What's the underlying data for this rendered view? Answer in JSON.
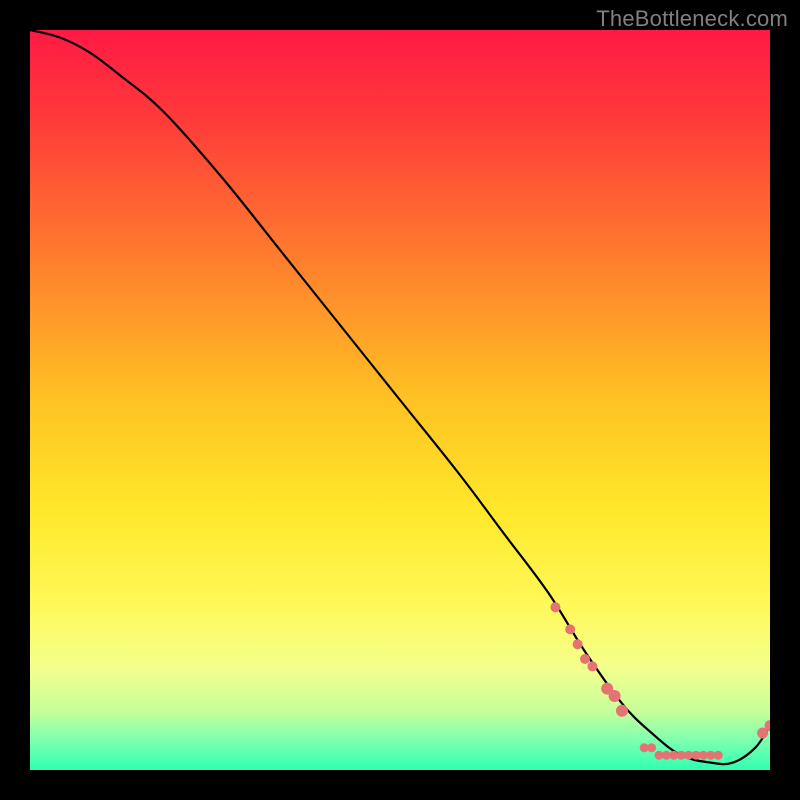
{
  "watermark": "TheBottleneck.com",
  "chart_data": {
    "type": "line",
    "title": "",
    "xlabel": "",
    "ylabel": "",
    "xlim": [
      0,
      100
    ],
    "ylim": [
      0,
      100
    ],
    "grid": false,
    "legend": false,
    "gradient_stops": [
      {
        "offset": 0,
        "color": "#ff1a44"
      },
      {
        "offset": 0.12,
        "color": "#ff3a3a"
      },
      {
        "offset": 0.3,
        "color": "#ff7a2e"
      },
      {
        "offset": 0.5,
        "color": "#ffc223"
      },
      {
        "offset": 0.65,
        "color": "#ffe82a"
      },
      {
        "offset": 0.78,
        "color": "#fff95a"
      },
      {
        "offset": 0.86,
        "color": "#f4ff8c"
      },
      {
        "offset": 0.92,
        "color": "#c7ff9a"
      },
      {
        "offset": 0.96,
        "color": "#7dffb0"
      },
      {
        "offset": 1.0,
        "color": "#2fffb0"
      }
    ],
    "series": [
      {
        "name": "bottleneck-curve",
        "x": [
          0,
          4,
          8,
          12,
          18,
          26,
          34,
          42,
          50,
          58,
          64,
          70,
          75,
          80,
          84,
          88,
          92,
          95,
          98,
          100
        ],
        "y": [
          100,
          99,
          97,
          94,
          89,
          80,
          70,
          60,
          50,
          40,
          32,
          24,
          16,
          9,
          5,
          2,
          1,
          1,
          3,
          6
        ]
      }
    ],
    "markers": [
      {
        "x": 71,
        "y": 22,
        "r": 5.0
      },
      {
        "x": 73,
        "y": 19,
        "r": 5.0
      },
      {
        "x": 74,
        "y": 17,
        "r": 5.0
      },
      {
        "x": 75,
        "y": 15,
        "r": 5.0
      },
      {
        "x": 76,
        "y": 14,
        "r": 5.0
      },
      {
        "x": 78,
        "y": 11,
        "r": 6.0
      },
      {
        "x": 79,
        "y": 10,
        "r": 6.0
      },
      {
        "x": 80,
        "y": 8,
        "r": 6.0
      },
      {
        "x": 83,
        "y": 3,
        "r": 4.5
      },
      {
        "x": 84,
        "y": 3,
        "r": 4.5
      },
      {
        "x": 85,
        "y": 2,
        "r": 4.5
      },
      {
        "x": 86,
        "y": 2,
        "r": 4.5
      },
      {
        "x": 87,
        "y": 2,
        "r": 4.5
      },
      {
        "x": 88,
        "y": 2,
        "r": 4.5
      },
      {
        "x": 89,
        "y": 2,
        "r": 4.5
      },
      {
        "x": 90,
        "y": 2,
        "r": 4.5
      },
      {
        "x": 91,
        "y": 2,
        "r": 4.5
      },
      {
        "x": 92,
        "y": 2,
        "r": 4.5
      },
      {
        "x": 93,
        "y": 2,
        "r": 4.5
      },
      {
        "x": 99,
        "y": 5,
        "r": 5.5
      },
      {
        "x": 100,
        "y": 6,
        "r": 5.5
      }
    ],
    "marker_color": "#e57373",
    "curve_color": "#000000"
  }
}
